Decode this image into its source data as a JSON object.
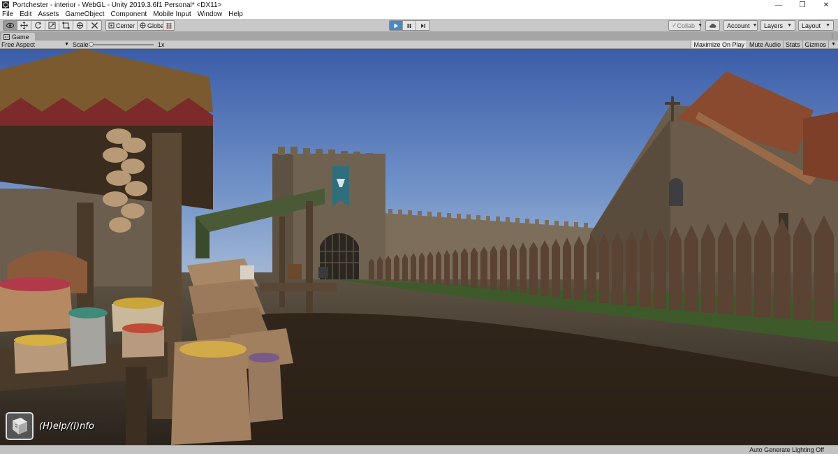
{
  "window": {
    "title": "Portchester - interior - WebGL - Unity 2019.3.6f1 Personal* <DX11>",
    "controls": {
      "minimize": "—",
      "maximize": "❐",
      "close": "✕"
    }
  },
  "menu": [
    "File",
    "Edit",
    "Assets",
    "GameObject",
    "Component",
    "Mobile Input",
    "Window",
    "Help"
  ],
  "toolbar": {
    "tools": [
      "hand-tool",
      "move-tool",
      "rotate-tool",
      "scale-tool",
      "rect-tool",
      "transform-tool",
      "custom-tool"
    ],
    "pivot_mode": "Center",
    "pivot_rotation": "Global",
    "play_state": "playing",
    "collab_label": "Collab",
    "account_label": "Account",
    "layers_label": "Layers",
    "layout_label": "Layout"
  },
  "game_tab": {
    "label": "Game"
  },
  "game_bar": {
    "aspect_label": "Free Aspect",
    "scale_label": "Scale",
    "scale_value": "1x",
    "maximize_label": "Maximize On Play",
    "mute_label": "Mute Audio",
    "stats_label": "Stats",
    "gizmos_label": "Gizmos"
  },
  "game_view": {
    "help_label": "(H)elp/(I)nfo"
  },
  "status_bar": {
    "message": "Auto Generate Lighting Off"
  }
}
